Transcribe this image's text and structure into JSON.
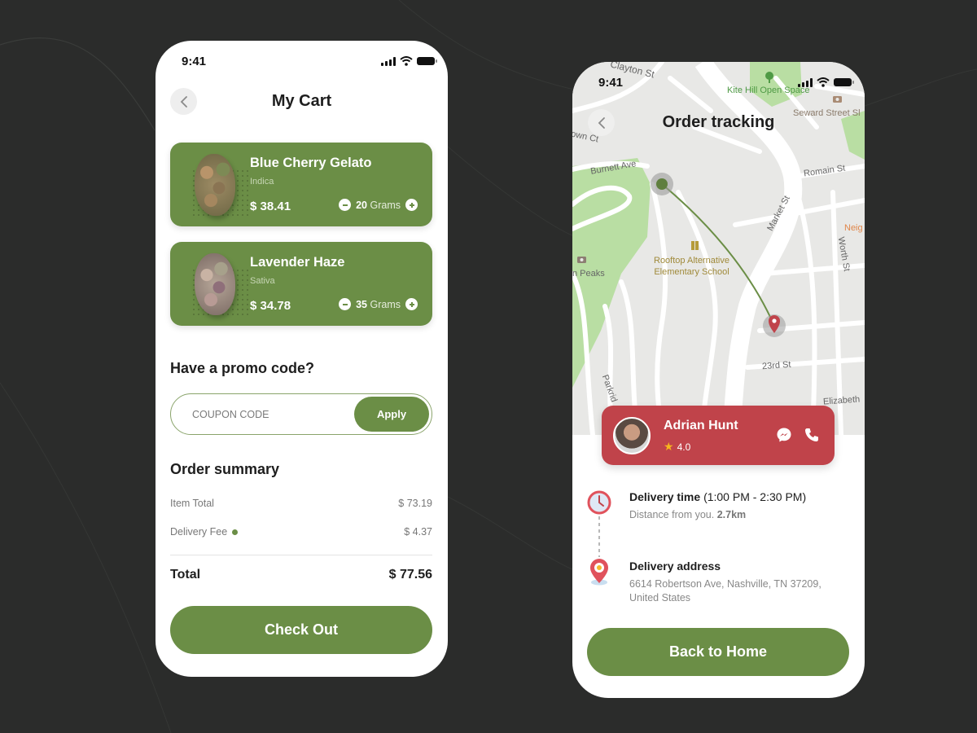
{
  "cart_screen": {
    "status_bar": {
      "time": "9:41"
    },
    "header": {
      "title": "My Cart",
      "back_icon": "chevron-left-icon"
    },
    "items": [
      {
        "name": "Blue Cherry Gelato",
        "type": "Indica",
        "price": "$ 38.41",
        "quantity": "20",
        "unit": "Grams"
      },
      {
        "name": "Lavender Haze",
        "type": "Sativa",
        "price": "$ 34.78",
        "quantity": "35",
        "unit": "Grams"
      }
    ],
    "promo": {
      "title": "Have a promo code?",
      "placeholder": "COUPON CODE",
      "value": "",
      "apply_label": "Apply"
    },
    "summary": {
      "title": "Order summary",
      "rows": [
        {
          "label": "Item Total",
          "value": "$ 73.19"
        },
        {
          "label": "Delivery Fee",
          "value": "$ 4.37"
        }
      ],
      "total_label": "Total",
      "total_value": "$ 77.56"
    },
    "checkout_label": "Check Out"
  },
  "tracking_screen": {
    "status_bar": {
      "time": "9:41"
    },
    "header": {
      "title": "Order tracking",
      "back_icon": "chevron-left-icon"
    },
    "map": {
      "labels": {
        "clayton": "Clayton St",
        "kite_hill": "Kite Hill Open Space",
        "seward": "Seward Street Sl",
        "town_ct": "own Ct",
        "burnett": "Burnett Ave",
        "romain": "Romain St",
        "market": "Market St",
        "neigh": "Neig",
        "worth": "Worth St",
        "peaks": "n Peaks",
        "school": "Rooftop Alternative Elementary School",
        "school_line1": "Rooftop Alternative",
        "school_line2": "Elementary School",
        "st23": "23rd St",
        "parkridge": "Parkrid",
        "elizabeth": "Elizabeth"
      }
    },
    "driver": {
      "name": "Adrian Hunt",
      "rating": "4.0",
      "accent_color": "#c0434a"
    },
    "delivery_time": {
      "title": "Delivery time",
      "window": "(1:00 PM - 2:30 PM)",
      "distance_prefix": "Distance from you.",
      "distance": "2.7km"
    },
    "delivery_address": {
      "title": "Delivery address",
      "address": "6614 Robertson Ave, Nashville, TN 37209, United States"
    },
    "back_home_label": "Back to Home"
  },
  "theme": {
    "primary_green": "#6b8e46",
    "driver_red": "#c0434a",
    "background": "#2b2c2b"
  }
}
